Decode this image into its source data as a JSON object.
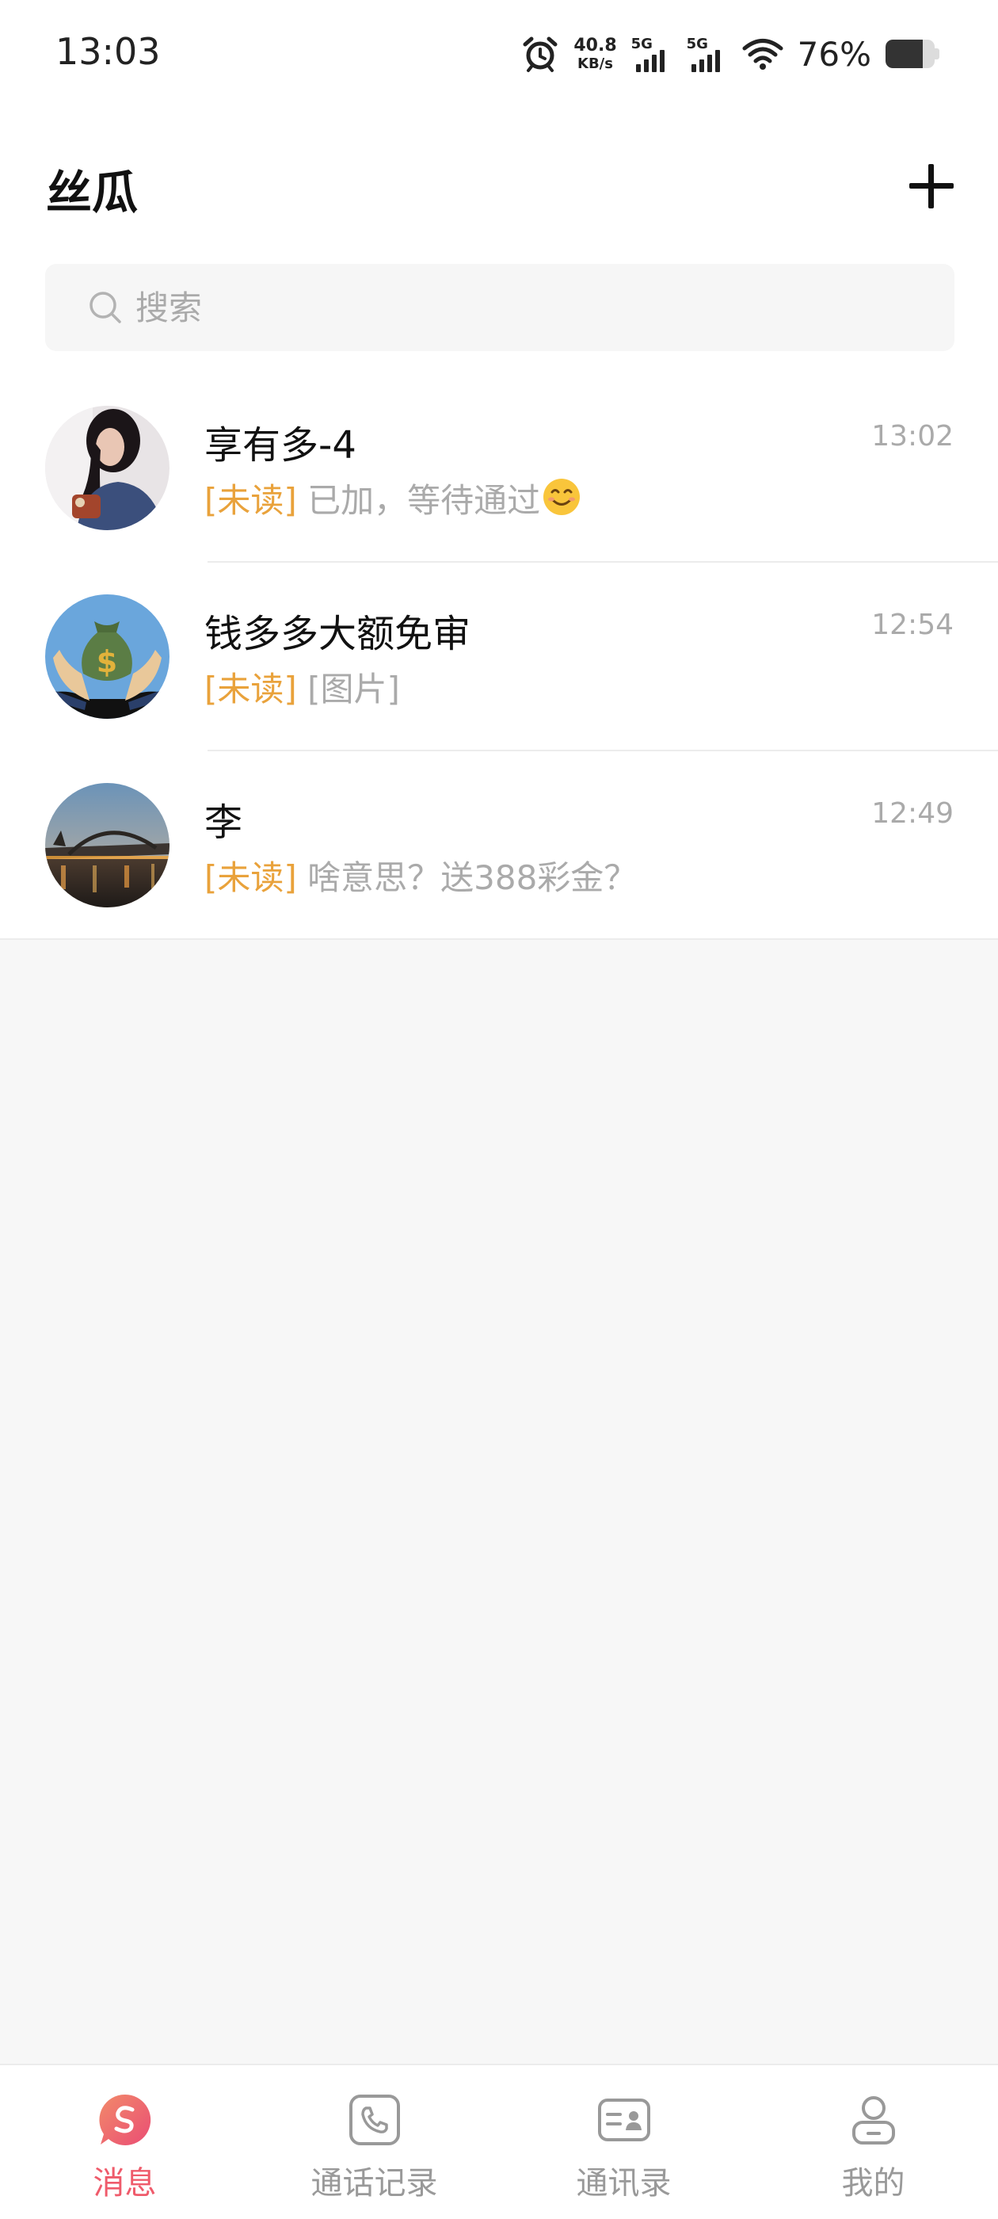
{
  "status_bar": {
    "time": "13:03",
    "net_speed_value": "40.8",
    "net_speed_unit": "KB/s",
    "sim1_label": "5G",
    "sim2_label": "5G",
    "battery_percent_text": "76%",
    "battery_level": 0.76,
    "icons": [
      "alarm-icon",
      "signal-icon",
      "wifi-icon",
      "battery-icon"
    ]
  },
  "header": {
    "title": "丝瓜",
    "add_icon": "plus-icon"
  },
  "search": {
    "placeholder": "搜索",
    "icon": "search-icon"
  },
  "conversations": [
    {
      "name": "享有多-4",
      "time": "13:02",
      "unread_tag": "[未读]",
      "message": "已加，等待通过",
      "emoji": "😊",
      "avatar": "avatar-woman"
    },
    {
      "name": "钱多多大额免审",
      "time": "12:54",
      "unread_tag": "[未读]",
      "message": "[图片]",
      "avatar": "avatar-money-bag"
    },
    {
      "name": "李",
      "time": "12:49",
      "unread_tag": "[未读]",
      "message": "啥意思？送388彩金？",
      "avatar": "avatar-bridge"
    }
  ],
  "bottom_nav": {
    "items": [
      {
        "label": "消息",
        "icon": "message-icon",
        "active": true
      },
      {
        "label": "通话记录",
        "icon": "phone-icon",
        "active": false
      },
      {
        "label": "通讯录",
        "icon": "contacts-icon",
        "active": false
      },
      {
        "label": "我的",
        "icon": "profile-icon",
        "active": false
      }
    ]
  },
  "colors": {
    "accent": "#ef5b6b",
    "unread": "#e9a23b",
    "muted_text": "#aaaaaa"
  }
}
